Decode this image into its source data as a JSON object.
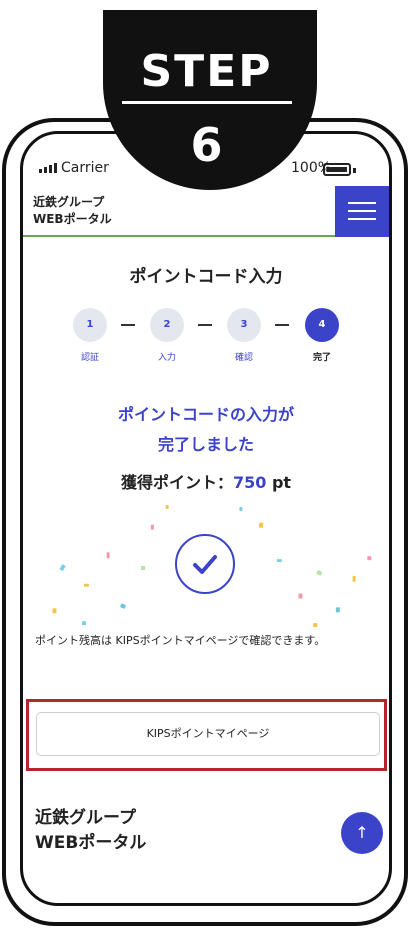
{
  "step_badge": {
    "title": "STEP",
    "number": "6"
  },
  "status_bar": {
    "carrier": "Carrier",
    "battery": "100%"
  },
  "header": {
    "logo_line1": "近鉄グループ",
    "logo_line2": "WEBポータル",
    "menu_icon": "hamburger-icon"
  },
  "page_title": "ポイントコード入力",
  "stepper": [
    {
      "num": "1",
      "label": "認証"
    },
    {
      "num": "2",
      "label": "入力"
    },
    {
      "num": "3",
      "label": "確認"
    },
    {
      "num": "4",
      "label": "完了"
    }
  ],
  "completion": {
    "line1": "ポイントコードの入力が",
    "line2": "完了しました",
    "points_label": "獲得ポイント：",
    "points_value": "750",
    "points_unit": "pt"
  },
  "note": "ポイント残高は KIPSポイントマイページで確認できます。",
  "kips_button": "KIPSポイントマイページ",
  "footer": {
    "logo_line1": "近鉄グループ",
    "logo_line2": "WEBポータル"
  },
  "colors": {
    "accent": "#3b44c9",
    "highlight": "#b3262b",
    "header_line": "#6aa84f"
  }
}
